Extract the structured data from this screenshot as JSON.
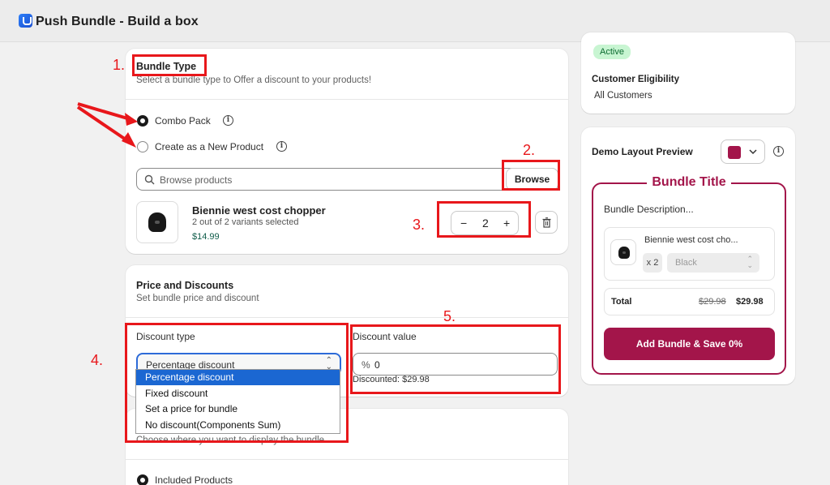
{
  "app": {
    "title": "Push Bundle - Build a box"
  },
  "bundle_type": {
    "title": "Bundle Type",
    "subtitle": "Select a bundle type to Offer a discount to your products!",
    "options": [
      {
        "label": "Combo Pack",
        "selected": true
      },
      {
        "label": "Create as a New Product",
        "selected": false
      }
    ],
    "search_placeholder": "Browse products",
    "browse_label": "Browse",
    "product": {
      "name": "Biennie west cost chopper",
      "variants": "2 out of 2 variants selected",
      "price": "$14.99",
      "quantity": "2"
    }
  },
  "price": {
    "title": "Price and Discounts",
    "subtitle": "Set bundle price and discount",
    "discount_type_label": "Discount type",
    "discount_type_value": "Percentage discount",
    "options": [
      "Percentage discount",
      "Fixed discount",
      "Set a price for bundle",
      "No discount(Components Sum)"
    ],
    "discount_value_label": "Discount value",
    "discount_prefix": "%",
    "discount_value": "0",
    "discounted_text": "Discounted: $29.98"
  },
  "display": {
    "subtitle": "Choose where you want to display the bundle.",
    "option": "Included Products"
  },
  "status": {
    "badge": "Active",
    "eligibility_label": "Customer Eligibility",
    "eligibility_value": "All Customers"
  },
  "preview": {
    "title": "Demo Layout Preview",
    "swatch_color": "#a3154a",
    "bundle_title": "Bundle Title",
    "bundle_description": "Bundle Description...",
    "item_name": "Biennie west cost cho...",
    "item_qty": "x 2",
    "item_variant": "Black",
    "total_label": "Total",
    "old_price": "$29.98",
    "new_price": "$29.98",
    "button_label": "Add Bundle & Save 0%"
  },
  "annotations": [
    "1.",
    "2.",
    "3.",
    "4.",
    "5."
  ],
  "colors": {
    "annotation_red": "#e8171b",
    "accent": "#a3154a",
    "selection_blue": "#1b67d2"
  }
}
